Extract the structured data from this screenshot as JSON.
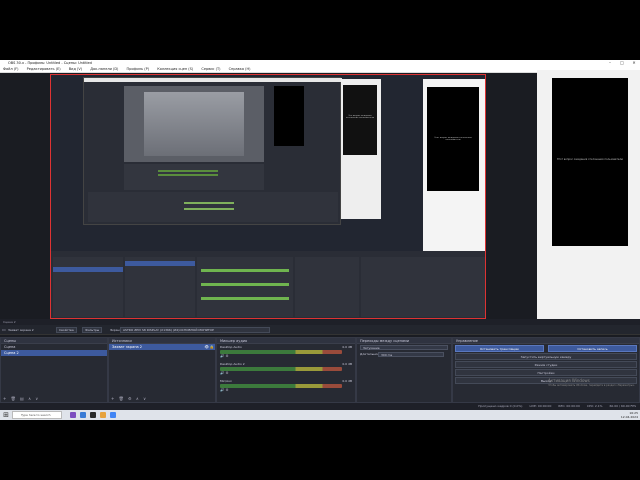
{
  "window": {
    "title": "OBS 30.x - Профиль: Untitled - Сцены: Untitled",
    "minimize": "–",
    "maximize": "□",
    "close": "✕"
  },
  "menu": [
    "Файл (F)",
    "Редактировать (E)",
    "Вид (V)",
    "Док-панели (D)",
    "Профиль (P)",
    "Коллекция сцен (S)",
    "Сервис (T)",
    "Справка (H)"
  ],
  "preview": {
    "scene_label": "Сцена 2",
    "overlay_text": "Это вопрос ожидания отклонения пользователю",
    "right_overlay_text": "Этот вопрос ожидания отклонения пользователю"
  },
  "strip": {
    "source_label": "Захват экрана 2",
    "properties": "Свойства",
    "filters": "Фильтры",
    "screen_label": "Экран",
    "screen_value": "ASTRO ZPIV S8 DISPLAY (X1366) (И2)ОСНОВНОЙ МОНИТОР"
  },
  "docks": {
    "scenes": {
      "title": "Сцены",
      "items": [
        "Сцена",
        "Сцена 2"
      ],
      "selected": 1
    },
    "sources": {
      "title": "Источники",
      "items": [
        "Захват экрана 2"
      ]
    },
    "mixer": {
      "title": "Микшер аудио",
      "channels": [
        {
          "name": "Desktop Audio",
          "db": "0.0 dB"
        },
        {
          "name": "Desktop Audio 2",
          "db": "0.0 dB"
        },
        {
          "name": "Mic/Aux",
          "db": "0.0 dB"
        }
      ]
    },
    "transitions": {
      "title": "Переходы между сценами",
      "type_value": "Затухание",
      "duration_label": "Длительность",
      "duration_value": "300 ms"
    },
    "controls": {
      "title": "Управление",
      "start_stream": "Остановить трансляцию",
      "start_record": "Остановить запись",
      "virtual_cam": "Запустить виртуальную камеру",
      "studio_mode": "Режим студии",
      "settings": "Настройки",
      "exit": "Выход"
    }
  },
  "status": {
    "dropped": "Пропущено кадров 0 (0.0%)",
    "live": "LIVE: 00:00:00",
    "rec": "REC: 00:00:00",
    "cpu": "CPU: 2.1%",
    "fps": "60.00 / 60.00 FPS"
  },
  "windows_activation": {
    "line1": "Активация Windows",
    "line2": "Чтобы активировать Windows, перейдите в раздел «Параметры»."
  },
  "taskbar": {
    "search_placeholder": "Type here to search",
    "time": "16:25",
    "date": "12.04.2024"
  }
}
